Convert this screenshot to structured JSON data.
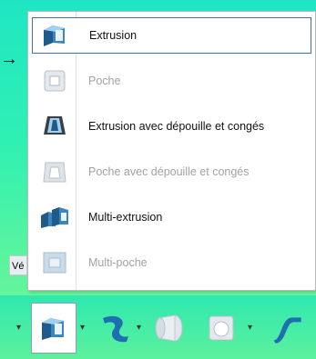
{
  "menu": {
    "items": [
      {
        "label": "Extrusion",
        "icon": "extrude-icon",
        "state": "selected"
      },
      {
        "label": "Poche",
        "icon": "pocket-icon",
        "state": "disabled"
      },
      {
        "label": "Extrusion avec dépouille et congés",
        "icon": "drafted-filleted-extrude-icon",
        "state": "enabled"
      },
      {
        "label": "Poche avec dépouille et congés",
        "icon": "drafted-filleted-pocket-icon",
        "state": "disabled"
      },
      {
        "label": "Multi-extrusion",
        "icon": "multi-extrude-icon",
        "state": "enabled"
      },
      {
        "label": "Multi-poche",
        "icon": "multi-pocket-icon",
        "state": "disabled"
      }
    ]
  },
  "toolbar": {
    "partial_label": "Vé",
    "drop_glyph": "▾",
    "buttons": [
      "extrude-icon",
      "revolve-icon",
      "groove-icon",
      "hole-icon",
      "rib-icon"
    ]
  },
  "pointer": {
    "glyph": "→"
  },
  "colors": {
    "bg_top": "#1fe6c2",
    "bg_bottom": "#78f590",
    "selection_border": "#3f6ea8",
    "icon_blue": "#1f5a88"
  }
}
